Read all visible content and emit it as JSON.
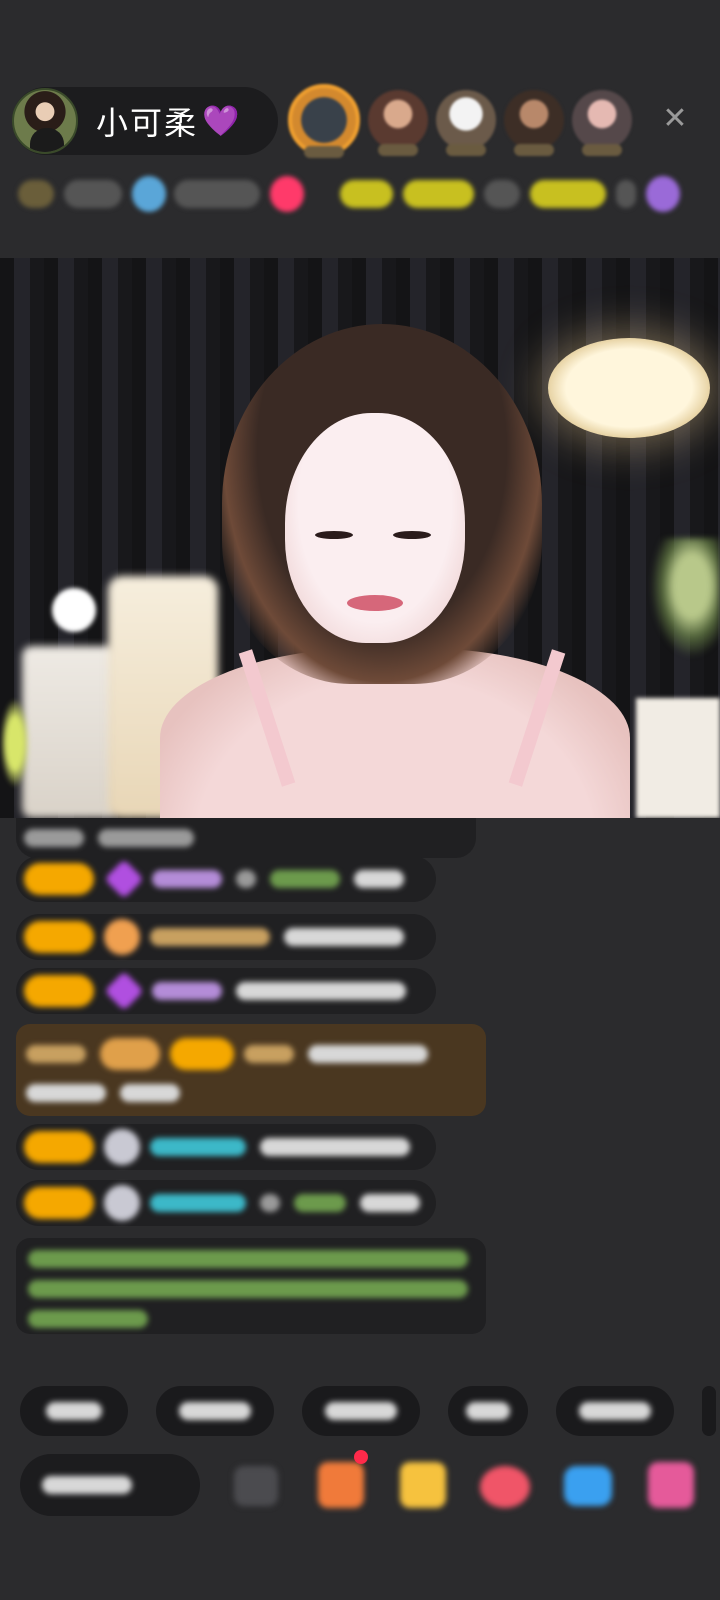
{
  "header": {
    "host_name": "小可柔",
    "host_heart": "💜",
    "close_label": "✕",
    "viewer_count_visible": 5
  },
  "chat": {
    "note": ""
  },
  "colors": {
    "background": "#2b2b2d",
    "level_badge": "#f5a800",
    "host_heart": "#a64dff"
  },
  "icons": {
    "close": "close-icon",
    "emoji": "emoji-icon",
    "fan_club": "fan-club-icon",
    "gift": "gift-icon",
    "like": "heart-icon",
    "game": "game-icon",
    "more": "more-icon"
  }
}
